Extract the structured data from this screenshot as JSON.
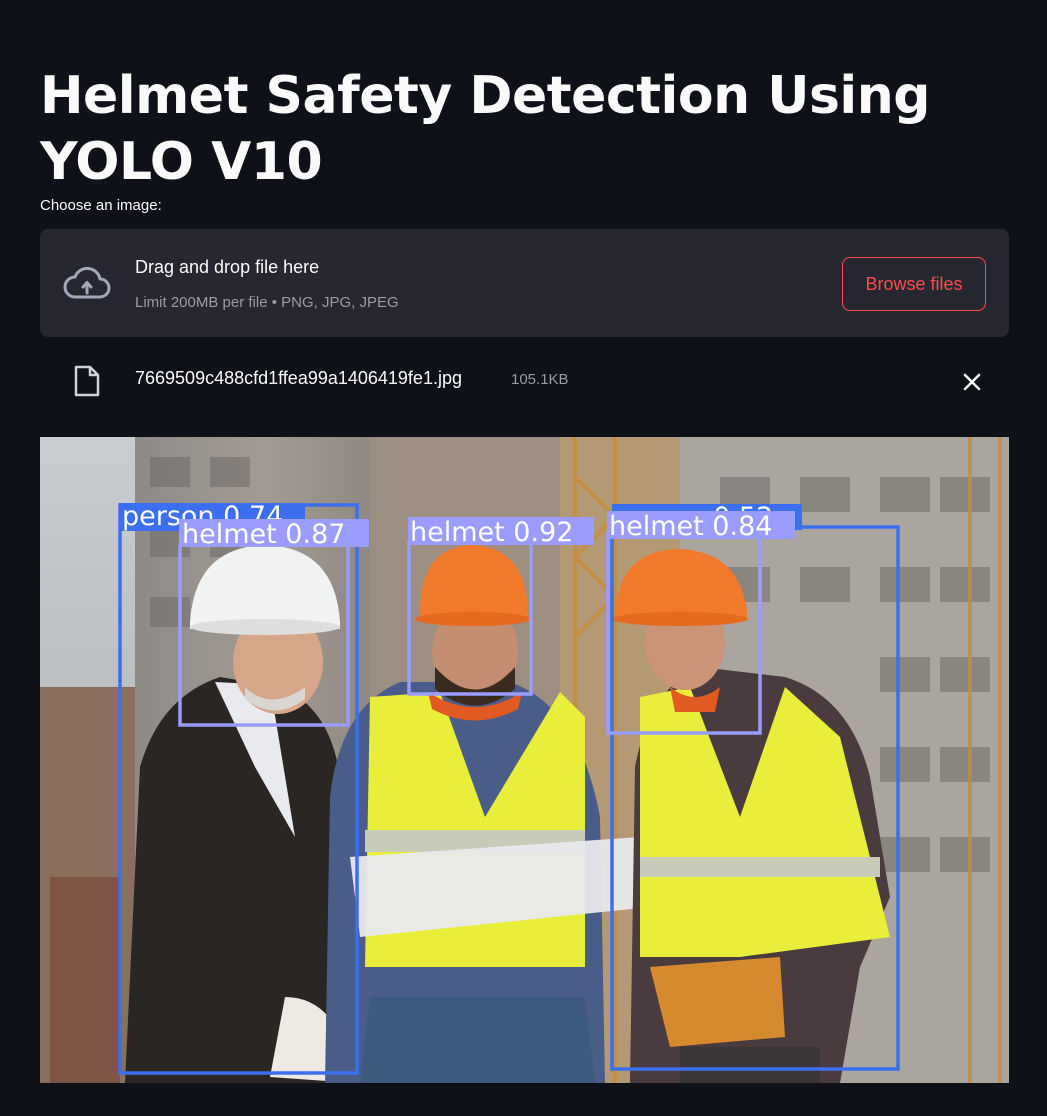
{
  "page": {
    "title": "Helmet Safety Detection Using YOLO V10"
  },
  "uploader": {
    "label": "Choose an image:",
    "drop_text": "Drag and drop file here",
    "limit_text": "Limit 200MB per file • PNG, JPG, JPEG",
    "browse_label": "Browse files",
    "icon": "cloud-upload-icon"
  },
  "uploaded_file": {
    "name": "7669509c488cfd1ffea99a1406419fe1.jpg",
    "size": "105.1KB",
    "icon": "file-icon",
    "remove_icon": "close-icon"
  },
  "detections": [
    {
      "label": "person 0.74",
      "color": "#3b6ff0"
    },
    {
      "label": "helmet 0.87",
      "color": "#9a9cff"
    },
    {
      "label": "helmet 0.92",
      "color": "#9a9cff"
    },
    {
      "label": "person 0.52",
      "color": "#3b6ff0"
    },
    {
      "label": "helmet 0.84",
      "color": "#9a9cff"
    }
  ],
  "theme": {
    "background": "#0e1117",
    "surface": "#262730",
    "accent": "#ff4b4b",
    "muted_text": "#9b9ca3"
  }
}
